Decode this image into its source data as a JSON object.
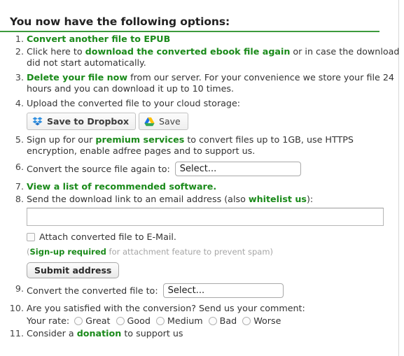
{
  "page": {
    "title": "You now have the following options:",
    "accent_green": "#1a8a1a",
    "rule_green": "#3c9a3c"
  },
  "options": {
    "item1": {
      "link": "Convert another file to EPUB"
    },
    "item2": {
      "pre": "Click here to ",
      "link": "download the converted ebook file again",
      "post": " or in case the download did not start automatically."
    },
    "item3": {
      "link": "Delete your file now",
      "post": " from our server. For your convenience we store your file 24 hours and you can download it up to 10 times."
    },
    "item4": {
      "text": "Upload the converted file to your cloud storage:",
      "dropbox_label": "Save to Dropbox",
      "gdrive_label": "Save"
    },
    "item5": {
      "pre": "Sign up for our ",
      "link": "premium services",
      "post": " to convert files up to 1GB, use HTTPS encryption, enable adfree pages and to support us."
    },
    "item6": {
      "label": "Convert the source file again to:",
      "select_value": "Select..."
    },
    "item7": {
      "link": "View a list of recommended software."
    },
    "item8": {
      "pre": "Send the download link to an email address (also ",
      "link": "whitelist us",
      "post": "):",
      "email_value": "",
      "email_placeholder": "",
      "attach_label": "Attach converted file to E-Mail.",
      "note_open": "(",
      "note_link": "Sign-up required",
      "note_rest": " for attachment feature to prevent spam)",
      "submit_label": "Submit address"
    },
    "item9": {
      "label": "Convert the converted file to:",
      "select_value": "Select..."
    },
    "item10": {
      "question": "Are you satisfied with the conversion? Send us your comment:",
      "rate_label": "Your rate:",
      "ratings": [
        "Great",
        "Good",
        "Medium",
        "Bad",
        "Worse"
      ]
    },
    "item11": {
      "pre": "Consider a ",
      "link": "donation",
      "post": " to support us"
    }
  }
}
